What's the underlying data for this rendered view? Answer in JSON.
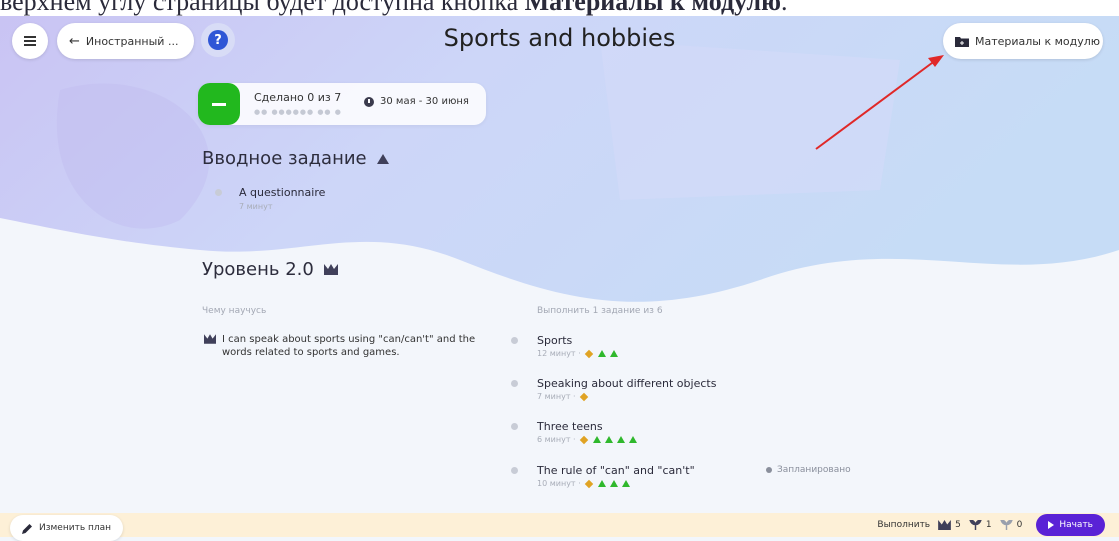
{
  "caption": {
    "text_before": "верхнем углу страницы будет доступна кнопка ",
    "text_bold": "Материалы к модулю",
    "text_after": "."
  },
  "header": {
    "back_label": "Иностранный ...",
    "title": "Sports and hobbies",
    "materials_label": "Материалы к модулю"
  },
  "progress": {
    "done_text": "Сделано 0 из 7",
    "dates": "30 мая - 30 июня"
  },
  "intro": {
    "title": "Вводное задание",
    "task_title": "A questionnaire",
    "task_meta": "7 минут"
  },
  "level": {
    "title": "Уровень 2.0",
    "learn_label": "Чему научусь",
    "goal_text": "I can speak about sports using \"can/can't\" and the words related to sports and games.",
    "complete_label": "Выполнить 1 задание из 6",
    "tasks": [
      {
        "title": "Sports",
        "meta": "12 минут ·",
        "diamonds": 1,
        "triangles": 2
      },
      {
        "title": "Speaking about different objects",
        "meta": "7 минут ·",
        "diamonds": 1,
        "triangles": 0
      },
      {
        "title": "Three teens",
        "meta": "6 минут ·",
        "diamonds": 1,
        "triangles": 4
      },
      {
        "title": "The rule of \"can\" and \"can't\"",
        "meta": "10 минут ·",
        "diamonds": 1,
        "triangles": 3
      }
    ],
    "planned_label": "Запланировано"
  },
  "footer": {
    "edit_label": "Изменить план",
    "complete_label": "Выполнить",
    "stat1": "5",
    "stat2": "1",
    "stat3": "0",
    "start_label": "Начать"
  },
  "colors": {
    "accent": "#5a22d6",
    "done": "#22b81e",
    "help": "#2f56d6",
    "arrow": "#e02828",
    "footer_bg": "#fdf0d7"
  }
}
